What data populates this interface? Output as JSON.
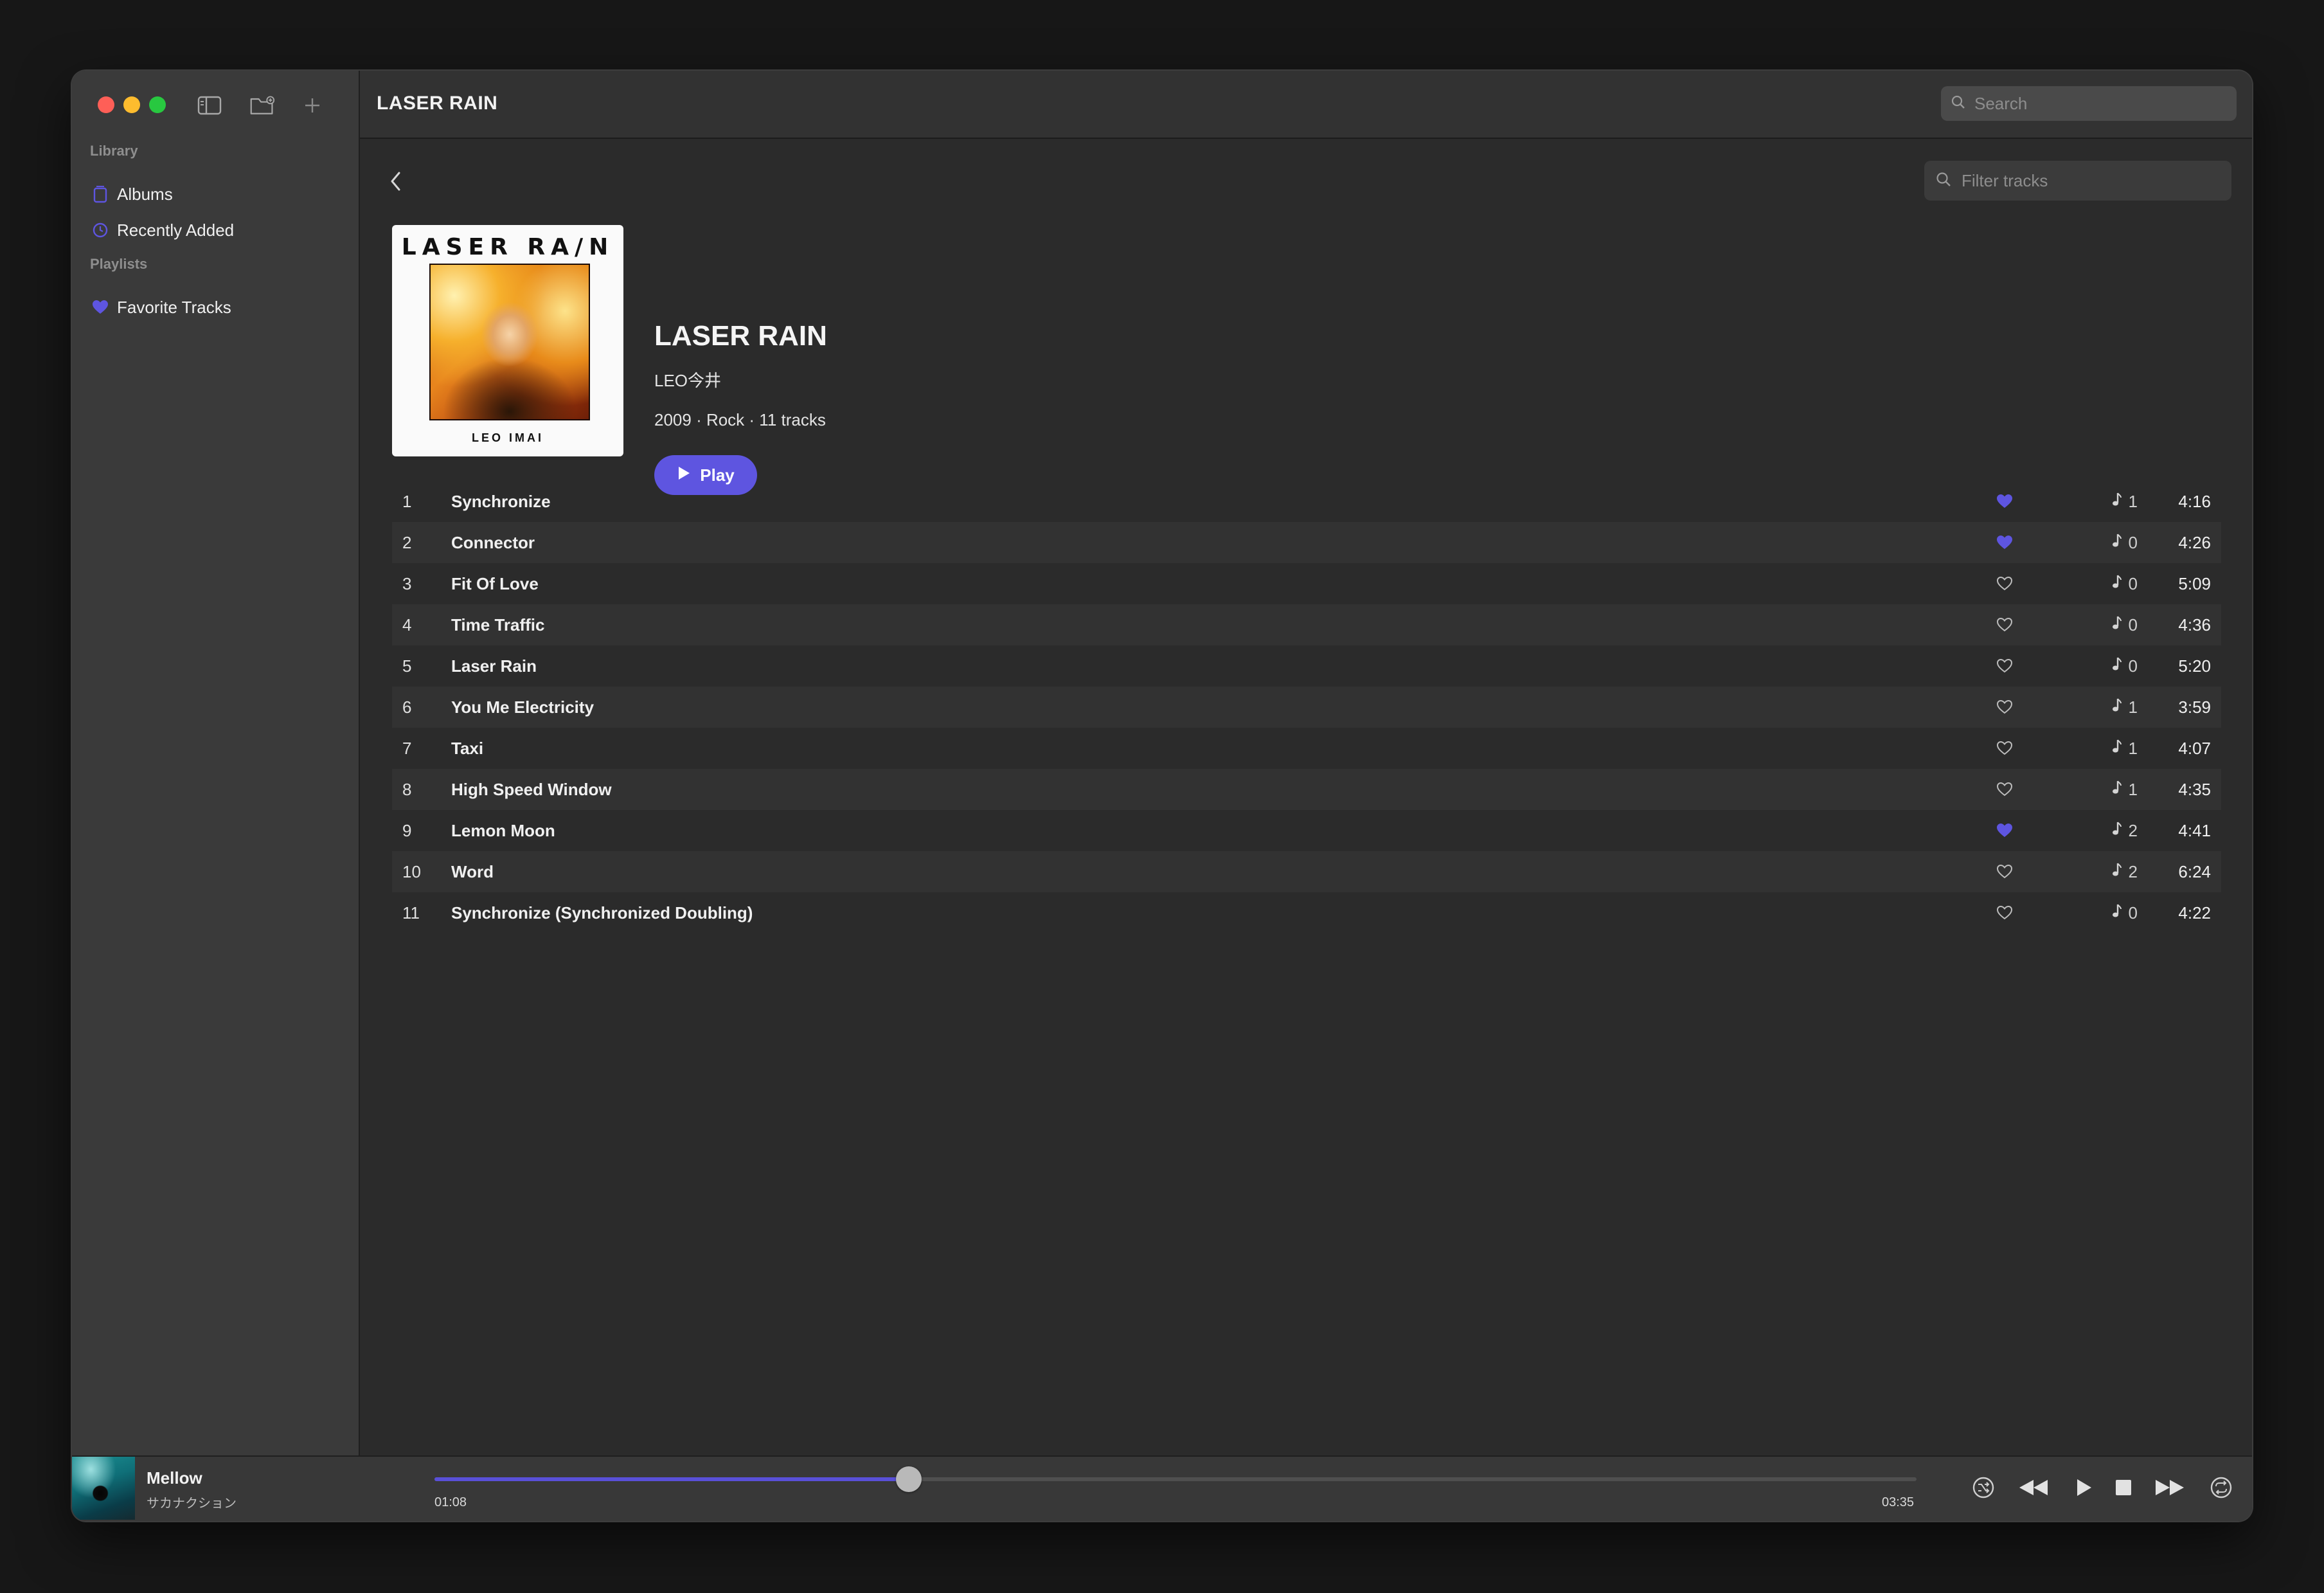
{
  "header": {
    "title": "LASER RAIN",
    "search_placeholder": "Search"
  },
  "sidebar": {
    "library_label": "Library",
    "library_items": [
      {
        "label": "Albums",
        "icon": "albums-icon"
      },
      {
        "label": "Recently Added",
        "icon": "clock-icon"
      }
    ],
    "playlists_label": "Playlists",
    "playlist_items": [
      {
        "label": "Favorite Tracks",
        "icon": "heart-icon"
      }
    ]
  },
  "album": {
    "title": "LASER RAIN",
    "artist": "LEO今井",
    "meta": "2009 · Rock · 11 tracks",
    "play_label": "Play",
    "cover_title": "LASER RA/N",
    "cover_artist": "LEO IMAI",
    "filter_placeholder": "Filter tracks"
  },
  "tracks": [
    {
      "num": "1",
      "title": "Synchronize",
      "favorite": true,
      "lyrics": "1",
      "duration": "4:16"
    },
    {
      "num": "2",
      "title": "Connector",
      "favorite": true,
      "lyrics": "0",
      "duration": "4:26"
    },
    {
      "num": "3",
      "title": "Fit Of Love",
      "favorite": false,
      "lyrics": "0",
      "duration": "5:09"
    },
    {
      "num": "4",
      "title": "Time Traffic",
      "favorite": false,
      "lyrics": "0",
      "duration": "4:36"
    },
    {
      "num": "5",
      "title": "Laser Rain",
      "favorite": false,
      "lyrics": "0",
      "duration": "5:20"
    },
    {
      "num": "6",
      "title": "You Me Electricity",
      "favorite": false,
      "lyrics": "1",
      "duration": "3:59"
    },
    {
      "num": "7",
      "title": "Taxi",
      "favorite": false,
      "lyrics": "1",
      "duration": "4:07"
    },
    {
      "num": "8",
      "title": "High Speed Window",
      "favorite": false,
      "lyrics": "1",
      "duration": "4:35"
    },
    {
      "num": "9",
      "title": "Lemon Moon",
      "favorite": true,
      "lyrics": "2",
      "duration": "4:41"
    },
    {
      "num": "10",
      "title": "Word",
      "favorite": false,
      "lyrics": "2",
      "duration": "6:24"
    },
    {
      "num": "11",
      "title": "Synchronize (Synchronized Doubling)",
      "favorite": false,
      "lyrics": "0",
      "duration": "4:22"
    }
  ],
  "player": {
    "title": "Mellow",
    "artist": "サカナクション",
    "current_time": "01:08",
    "total_time": "03:35",
    "progress": 0.32
  },
  "colors": {
    "accent": "#5e55e0",
    "favorite": "#5e55e0",
    "background": "#2b2b2b",
    "sidebar": "#3a3a3a"
  }
}
